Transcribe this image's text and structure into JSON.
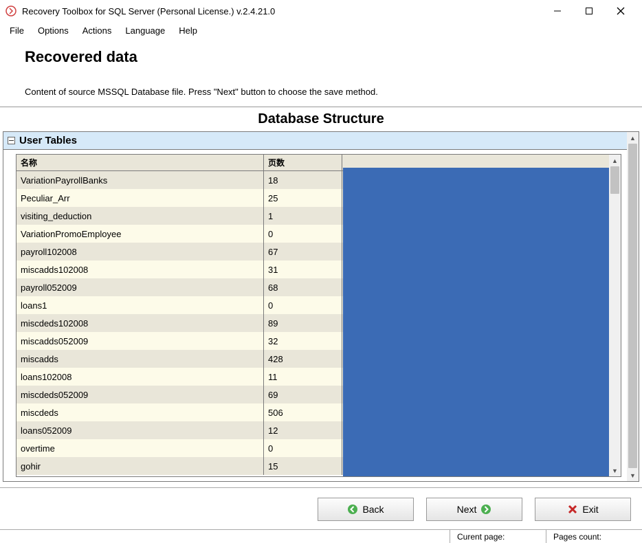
{
  "window": {
    "title": "Recovery Toolbox for SQL Server (Personal License.) v.2.4.21.0"
  },
  "menu": {
    "file": "File",
    "options": "Options",
    "actions": "Actions",
    "language": "Language",
    "help": "Help"
  },
  "heading": {
    "title": "Recovered data",
    "description": "Content of source MSSQL Database file. Press \"Next\" button to choose the save method."
  },
  "structure_title": "Database Structure",
  "section": {
    "label": "User Tables"
  },
  "table": {
    "headers": {
      "name": "名称",
      "pages": "页数"
    },
    "rows": [
      {
        "name": "VariationPayrollBanks",
        "pages": "18"
      },
      {
        "name": "Peculiar_Arr",
        "pages": "25"
      },
      {
        "name": "visiting_deduction",
        "pages": "1"
      },
      {
        "name": "VariationPromoEmployee",
        "pages": "0"
      },
      {
        "name": "payroll102008",
        "pages": "67"
      },
      {
        "name": "miscadds102008",
        "pages": "31"
      },
      {
        "name": "payroll052009",
        "pages": "68"
      },
      {
        "name": "loans1",
        "pages": "0"
      },
      {
        "name": "miscdeds102008",
        "pages": "89"
      },
      {
        "name": "miscadds052009",
        "pages": "32"
      },
      {
        "name": "miscadds",
        "pages": "428"
      },
      {
        "name": "loans102008",
        "pages": "11"
      },
      {
        "name": "miscdeds052009",
        "pages": "69"
      },
      {
        "name": "miscdeds",
        "pages": "506"
      },
      {
        "name": "loans052009",
        "pages": "12"
      },
      {
        "name": "overtime",
        "pages": "0"
      },
      {
        "name": "gohir",
        "pages": "15"
      }
    ]
  },
  "buttons": {
    "back": "Back",
    "next": "Next",
    "exit": "Exit"
  },
  "statusbar": {
    "current_page": "Curent page:",
    "pages_count": "Pages count:"
  }
}
